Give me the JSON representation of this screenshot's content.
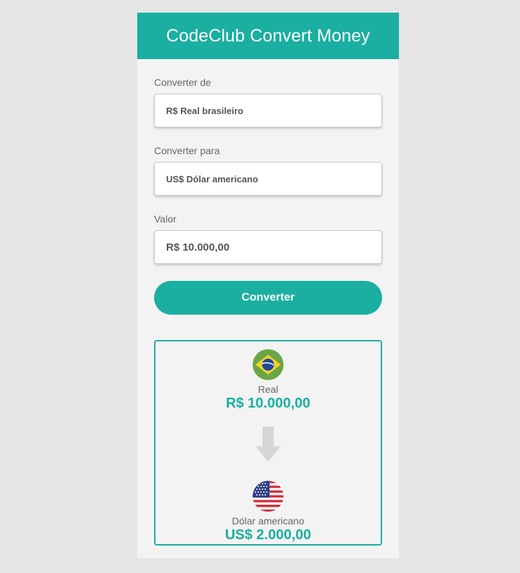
{
  "header": {
    "title": "CodeClub Convert Money"
  },
  "form": {
    "from_label": "Converter de",
    "from_value": "R$ Real brasileiro",
    "to_label": "Converter para",
    "to_value": "US$ Dólar americano",
    "amount_label": "Valor",
    "amount_value": "R$ 10.000,00",
    "convert_label": "Converter"
  },
  "result": {
    "from_currency_name": "Real",
    "from_amount": "R$ 10.000,00",
    "to_currency_name": "Dólar americano",
    "to_amount": "US$ 2.000,00",
    "from_flag_icon": "brazil-flag-icon",
    "to_flag_icon": "usa-flag-icon",
    "arrow_icon": "arrow-down-icon"
  },
  "colors": {
    "accent": "#1aafa1",
    "background": "#e5e5e5",
    "card": "#f3f3f3"
  }
}
